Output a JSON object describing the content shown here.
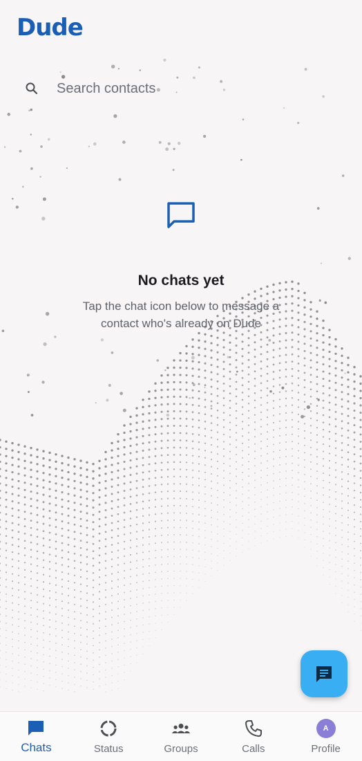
{
  "app": {
    "brand": "Dude"
  },
  "search": {
    "placeholder": "Search contacts",
    "value": ""
  },
  "empty_state": {
    "title": "No chats yet",
    "description": "Tap the chat icon below to message a contact who's already on Dude"
  },
  "fab": {
    "icon": "new-chat-icon"
  },
  "nav": {
    "items": [
      {
        "label": "Chats",
        "icon": "chat-bubble-icon",
        "active": true
      },
      {
        "label": "Status",
        "icon": "status-ring-icon",
        "active": false
      },
      {
        "label": "Groups",
        "icon": "groups-icon",
        "active": false
      },
      {
        "label": "Calls",
        "icon": "phone-icon",
        "active": false
      },
      {
        "label": "Profile",
        "icon": "avatar",
        "avatar_initial": "A",
        "active": false
      }
    ]
  },
  "colors": {
    "brand": "#1a5fb4",
    "fab": "#3aaef3",
    "background": "#f7f5f6",
    "avatar": "#8a7fd6"
  }
}
